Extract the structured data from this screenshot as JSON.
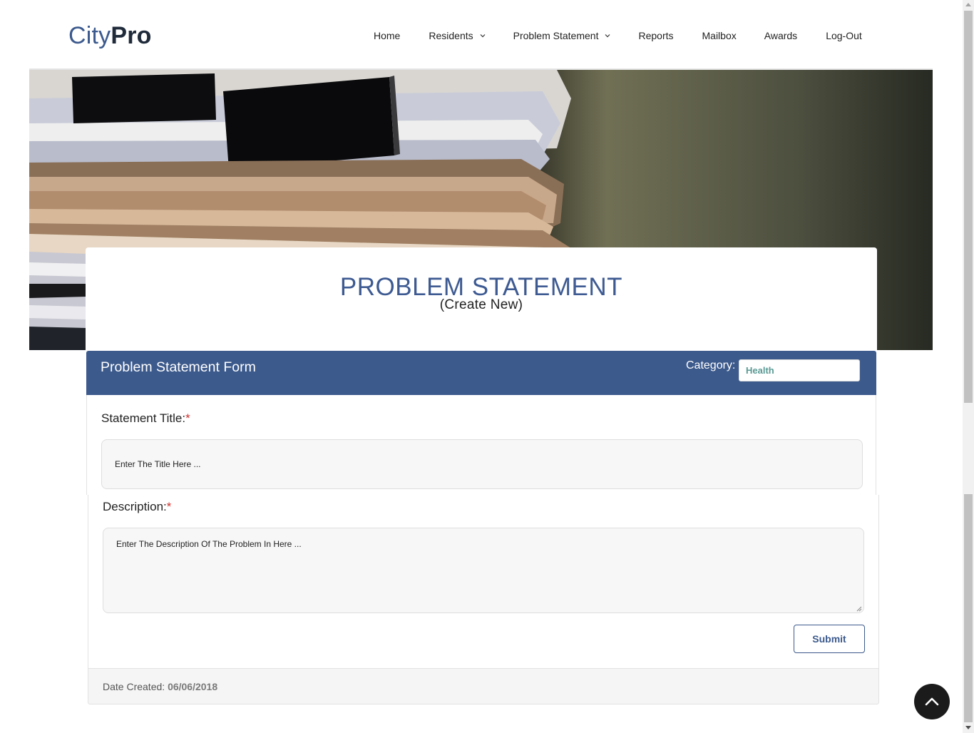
{
  "brand": {
    "light": "City",
    "bold": "Pro"
  },
  "nav": {
    "items": [
      {
        "label": "Home",
        "dropdown": false
      },
      {
        "label": "Residents",
        "dropdown": true
      },
      {
        "label": "Problem Statement",
        "dropdown": true
      },
      {
        "label": "Reports",
        "dropdown": false
      },
      {
        "label": "Mailbox",
        "dropdown": false
      },
      {
        "label": "Awards",
        "dropdown": false
      },
      {
        "label": "Log-Out",
        "dropdown": false
      }
    ]
  },
  "page": {
    "title": "PROBLEM STATEMENT",
    "subtitle": "(Create New)"
  },
  "form": {
    "header_title": "Problem Statement Form",
    "category_label": "Category:",
    "category_value": "Health",
    "title_label": "Statement Title:",
    "title_placeholder": "Enter The Title Here ...",
    "description_label": "Description:",
    "description_placeholder": "Enter The Description Of The Problem In Here ...",
    "required_mark": "*",
    "submit_label": "Submit"
  },
  "footer": {
    "date_label": "Date Created:",
    "date_value": "06/06/2018"
  },
  "icons": {
    "scroll_top": "chevron-up-icon",
    "dropdown": "chevron-down-icon"
  },
  "colors": {
    "brand_blue": "#3c5a8c",
    "title_blue": "#3d5a92",
    "required_red": "#d0312d",
    "category_text": "#5a9a94"
  }
}
